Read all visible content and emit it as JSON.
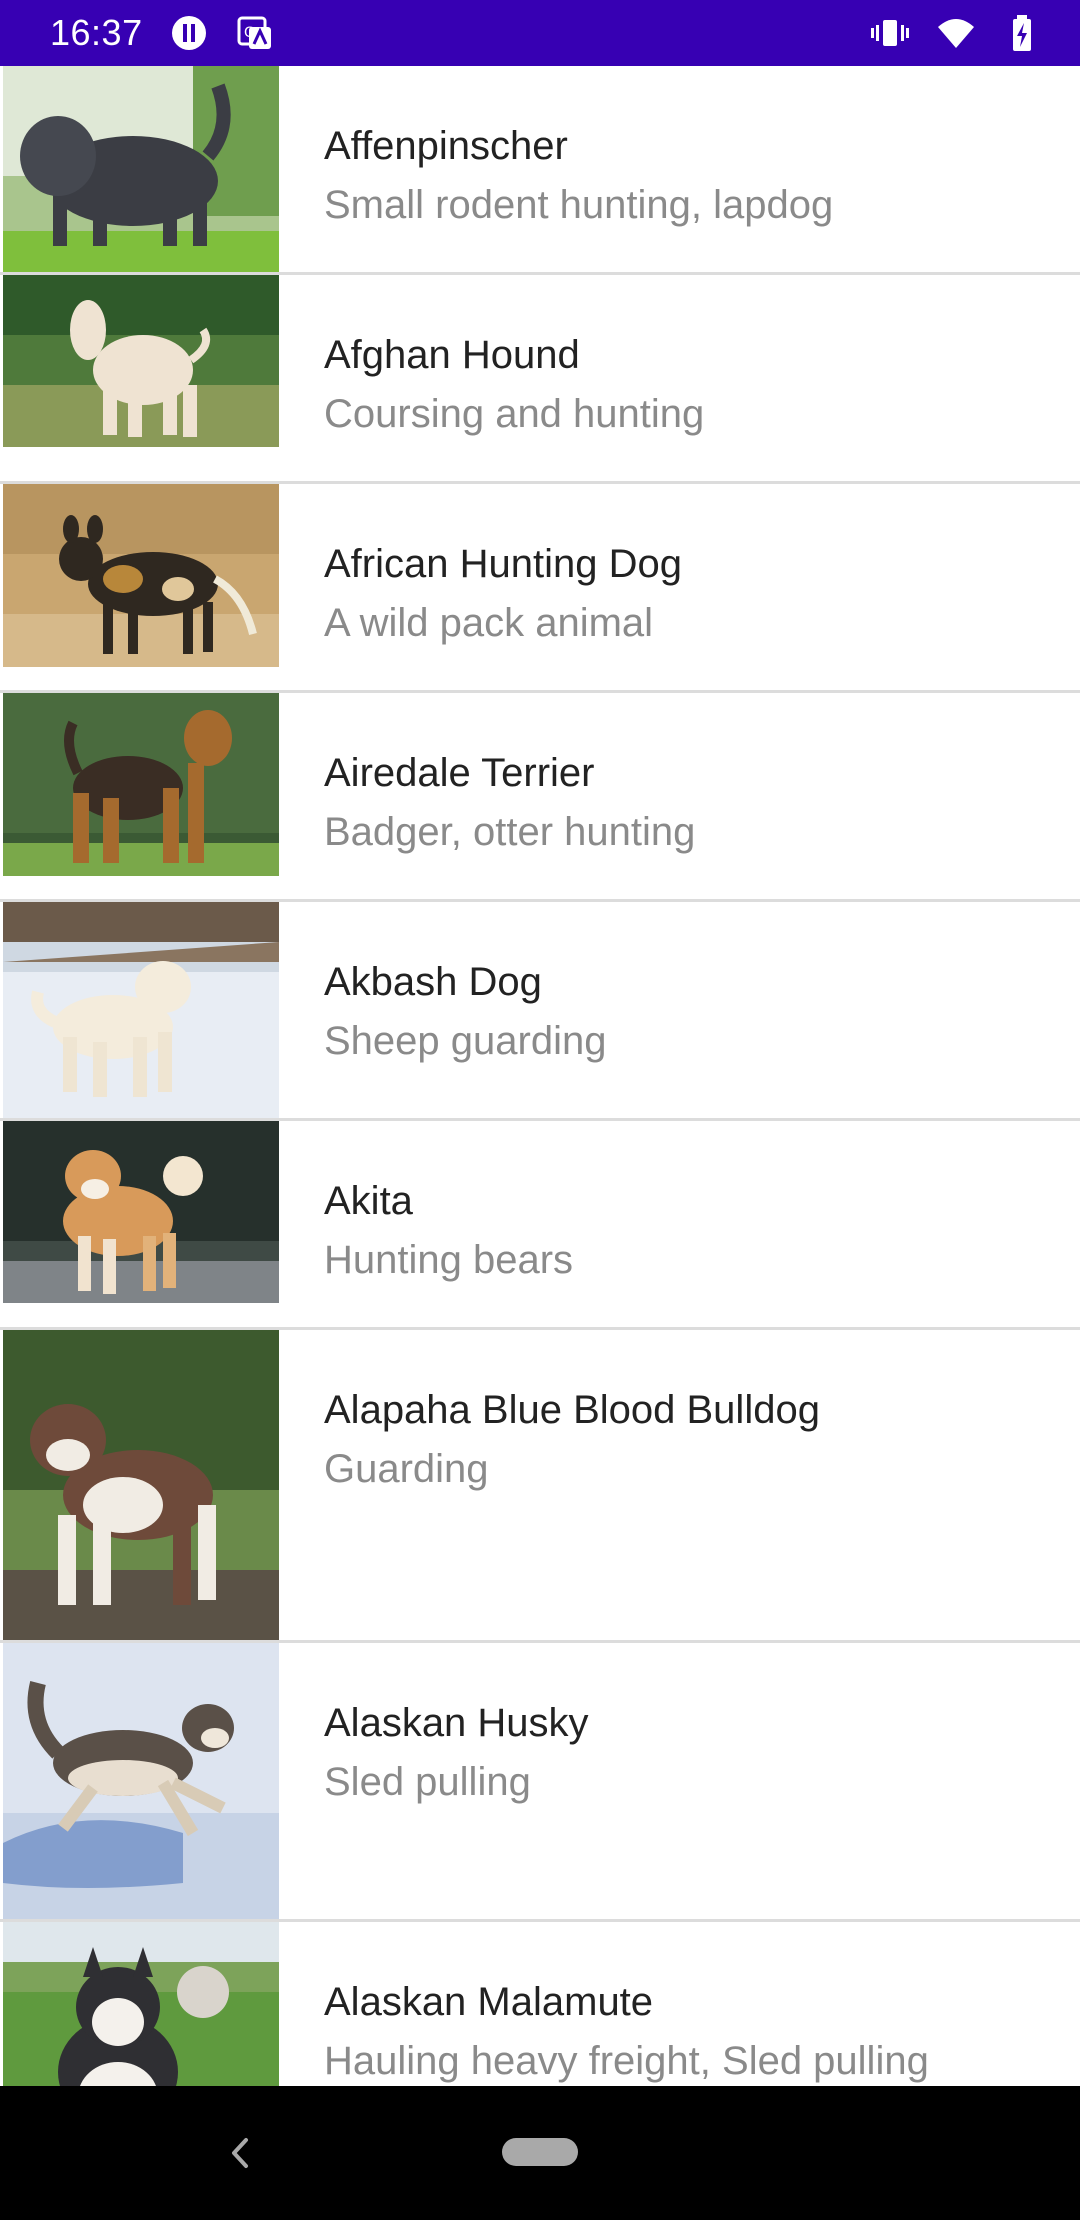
{
  "status_bar": {
    "time": "16:37",
    "background": "#3700b3",
    "left_icons": [
      "media-pause-icon",
      "translate-icon"
    ],
    "right_icons": [
      "vibrate-icon",
      "wifi-icon",
      "battery-charging-icon"
    ]
  },
  "breeds": [
    {
      "name": "Affenpinscher",
      "description": "Small rodent hunting, lapdog",
      "photo": "affenpinscher-photo"
    },
    {
      "name": "Afghan Hound",
      "description": "Coursing and hunting",
      "photo": "afghan-hound-photo"
    },
    {
      "name": "African Hunting Dog",
      "description": "A wild pack animal",
      "photo": "african-hunting-dog-photo"
    },
    {
      "name": "Airedale Terrier",
      "description": "Badger, otter hunting",
      "photo": "airedale-terrier-photo"
    },
    {
      "name": "Akbash Dog",
      "description": "Sheep guarding",
      "photo": "akbash-dog-photo"
    },
    {
      "name": "Akita",
      "description": "Hunting bears",
      "photo": "akita-photo"
    },
    {
      "name": "Alapaha Blue Blood Bulldog",
      "description": "Guarding",
      "photo": "alapaha-blue-blood-bulldog-photo"
    },
    {
      "name": "Alaskan Husky",
      "description": "Sled pulling",
      "photo": "alaskan-husky-photo"
    },
    {
      "name": "Alaskan Malamute",
      "description": "Hauling heavy freight, Sled pulling",
      "photo": "alaskan-malamute-photo"
    }
  ],
  "nav_bar": {
    "buttons": [
      "back-icon",
      "home-pill"
    ]
  },
  "colors": {
    "title_text": "#222222",
    "subtitle_text": "#8a8a8a",
    "divider": "#dcdcdc"
  }
}
